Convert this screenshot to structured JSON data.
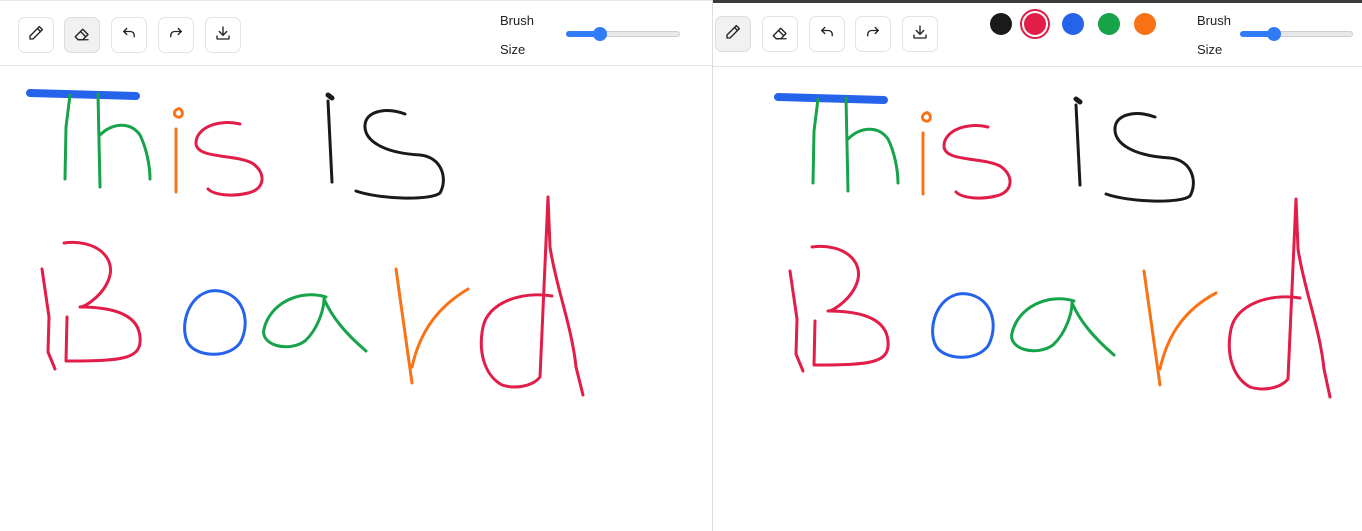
{
  "toolbar": {
    "brush_label": "Brush",
    "size_label": "Size",
    "brush_size_fraction": 0.3
  },
  "colors": {
    "black": "#1a1a1a",
    "red": "#e11d48",
    "blue": "#2563eb",
    "green": "#16a34a",
    "orange": "#f97316",
    "selected": "red"
  },
  "icons": {
    "pencil": "pencil-icon",
    "eraser": "eraser-icon",
    "undo": "undo-icon",
    "redo": "redo-icon",
    "download": "download-icon"
  }
}
